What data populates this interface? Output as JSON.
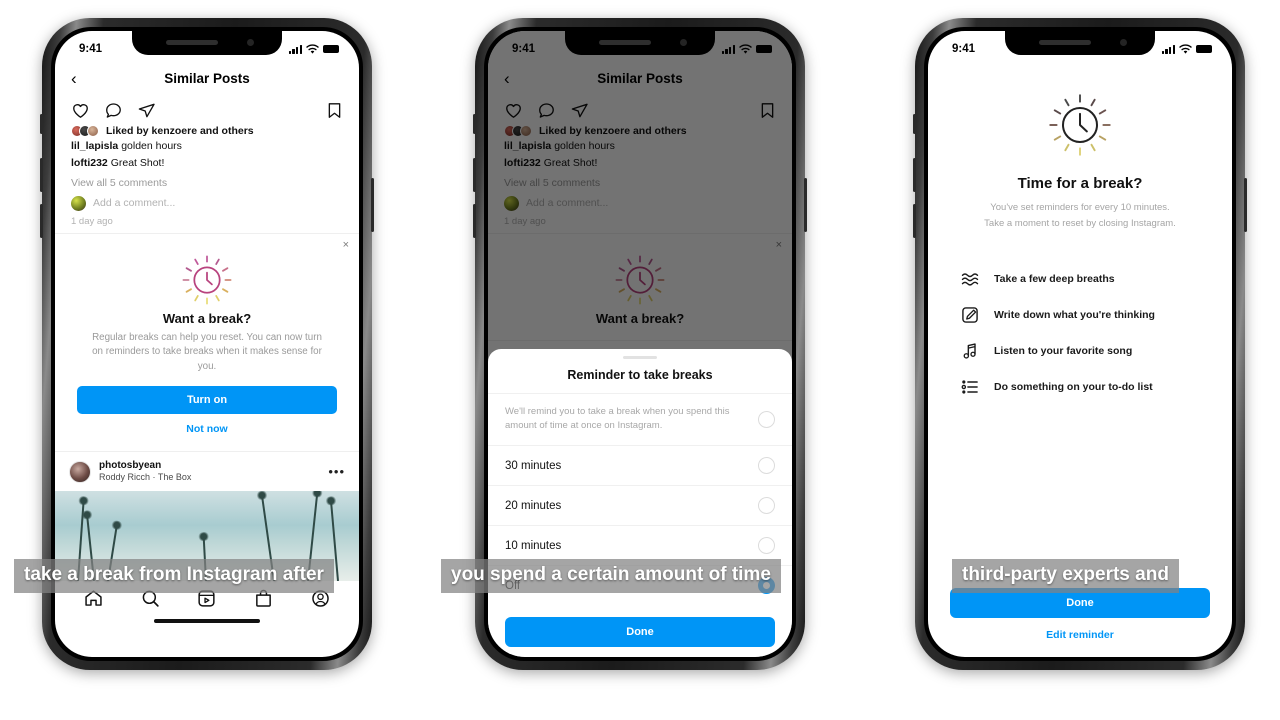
{
  "statusbar": {
    "time": "9:41"
  },
  "phone1": {
    "header": {
      "back_icon": "chevron-left-icon",
      "title": "Similar Posts"
    },
    "post": {
      "actions": [
        "heart-icon",
        "comment-icon",
        "share-icon",
        "bookmark-icon"
      ],
      "liked_by": "Liked by kenzoere and others",
      "comments": [
        {
          "user": "lil_lapisla",
          "text": "golden hours"
        },
        {
          "user": "lofti232",
          "text": "Great Shot!"
        }
      ],
      "view_all": "View all 5 comments",
      "add_comment_placeholder": "Add a comment...",
      "time_ago": "1 day ago"
    },
    "break_card": {
      "close_label": "×",
      "icon": "clock-rays-icon",
      "title": "Want a break?",
      "body": "Regular breaks can help you reset. You can now turn on reminders to take breaks when it makes sense for you.",
      "primary_label": "Turn on",
      "secondary_label": "Not now"
    },
    "next_post": {
      "username": "photosbyean",
      "audio": "Roddy Ricch · The Box",
      "more_label": "•••"
    },
    "tabbar": [
      "home-icon",
      "search-icon",
      "reels-icon",
      "shop-icon",
      "profile-icon"
    ]
  },
  "phone2": {
    "header": {
      "back_icon": "chevron-left-icon",
      "title": "Similar Posts"
    },
    "post": {
      "liked_by": "Liked by kenzoere and others",
      "comments": [
        {
          "user": "lil_lapisla",
          "text": "golden hours"
        },
        {
          "user": "lofti232",
          "text": "Great Shot!"
        }
      ],
      "view_all": "View all 5 comments",
      "add_comment_placeholder": "Add a comment...",
      "time_ago": "1 day ago"
    },
    "break_card": {
      "title": "Want a break?",
      "close_label": "×"
    },
    "sheet": {
      "title": "Reminder to take breaks",
      "description": "We'll remind you to take a break when you spend this amount of time at once on Instagram.",
      "options": [
        {
          "label": "30 minutes",
          "selected": false
        },
        {
          "label": "20 minutes",
          "selected": false
        },
        {
          "label": "10 minutes",
          "selected": false
        },
        {
          "label": "Off",
          "selected": true
        }
      ],
      "done_label": "Done"
    }
  },
  "phone3": {
    "icon": "clock-rays-icon",
    "title": "Time for a break?",
    "subtitle": "You've set reminders for every 10 minutes.\nTake a moment to reset by closing Instagram.",
    "subtitle_line1": "You've set reminders for every 10 minutes.",
    "subtitle_line2": "Take a moment to reset by closing Instagram.",
    "tips": [
      {
        "icon": "waves-icon",
        "label": "Take a few deep breaths"
      },
      {
        "icon": "note-pencil-icon",
        "label": "Write down what you're thinking"
      },
      {
        "icon": "music-note-icon",
        "label": "Listen to your favorite song"
      },
      {
        "icon": "checklist-icon",
        "label": "Do something on your to-do list"
      }
    ],
    "done_label": "Done",
    "edit_label": "Edit reminder"
  },
  "captions": {
    "one": "take a break from Instagram after",
    "two": "you spend a certain amount of time",
    "three": "third-party experts and"
  },
  "colors": {
    "accent": "#0095f6",
    "muted": "#9a9a9a",
    "caption_bg": "rgba(130,130,130,0.72)"
  }
}
